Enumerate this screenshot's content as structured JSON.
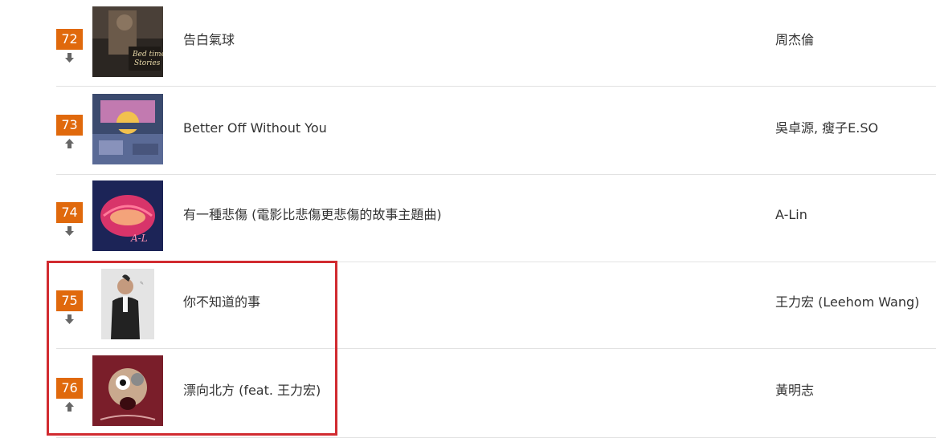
{
  "chart": {
    "rows": [
      {
        "rank": "72",
        "trend": "down",
        "title": "告白氣球",
        "artist": "周杰倫",
        "cover": "cover-72"
      },
      {
        "rank": "73",
        "trend": "up",
        "title": "Better Off Without You",
        "artist": "吳卓源, 瘦子E.SO",
        "cover": "cover-73"
      },
      {
        "rank": "74",
        "trend": "down",
        "title": "有一種悲傷 (電影比悲傷更悲傷的故事主題曲)",
        "artist": "A-Lin",
        "cover": "cover-74"
      },
      {
        "rank": "75",
        "trend": "down",
        "title": "你不知道的事",
        "artist": "王力宏 (Leehom Wang)",
        "cover": "cover-75"
      },
      {
        "rank": "76",
        "trend": "up",
        "title": "漂向北方 (feat. 王力宏)",
        "artist": "黃明志",
        "cover": "cover-76"
      }
    ]
  },
  "colors": {
    "rank_badge": "#e0690c",
    "highlight": "#d12b30",
    "divider": "#e2e2e2",
    "trend_icon": "#666666"
  },
  "icons": {
    "down": "arrow-down-icon",
    "up": "arrow-up-icon"
  }
}
